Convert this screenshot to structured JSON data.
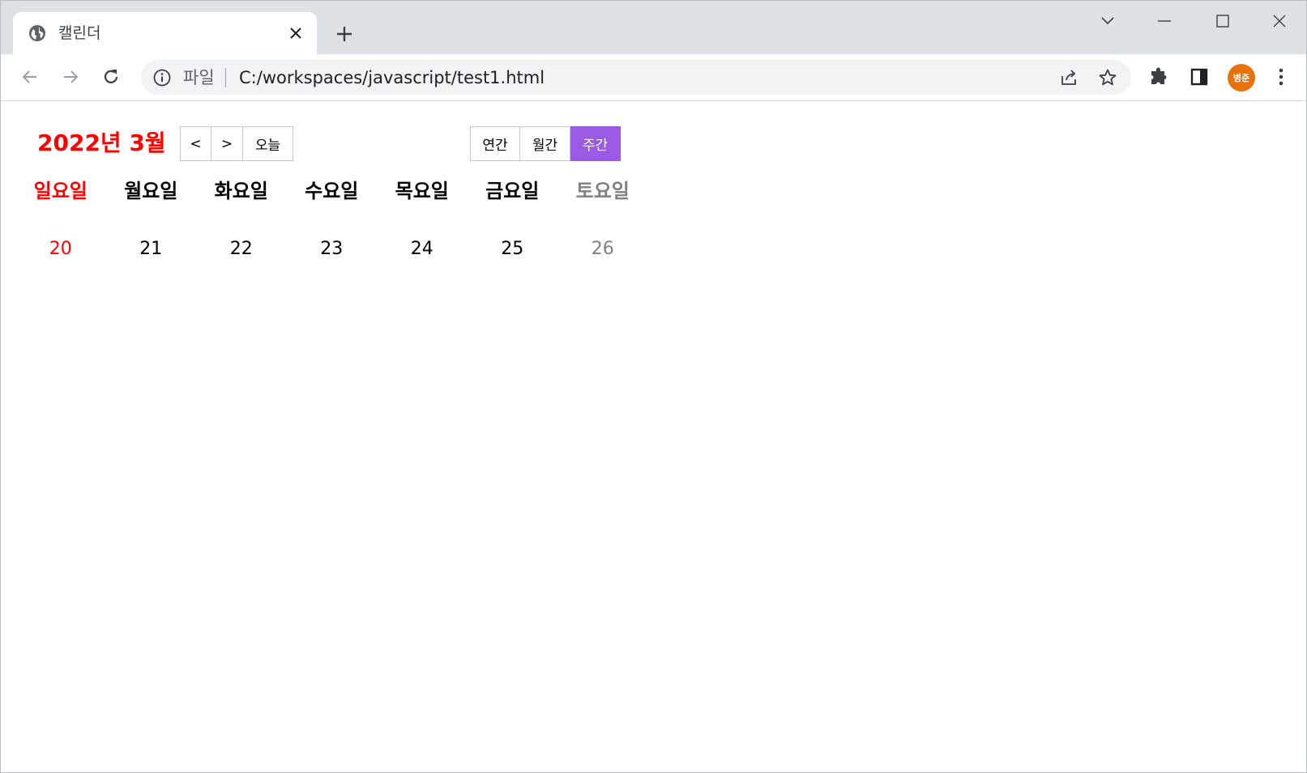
{
  "browser": {
    "tab": {
      "title": "캘린더"
    },
    "address": {
      "scheme_label": "파일",
      "url": "C:/workspaces/javascript/test1.html"
    },
    "profile": {
      "initials": "병준",
      "color": "#e8710a"
    }
  },
  "calendar": {
    "title": "2022년 3월",
    "nav": {
      "prev": "<",
      "next": ">",
      "today": "오늘"
    },
    "views": [
      {
        "label": "연간",
        "active": false
      },
      {
        "label": "월간",
        "active": false
      },
      {
        "label": "주간",
        "active": true
      }
    ],
    "weekdays": [
      "일요일",
      "월요일",
      "화요일",
      "수요일",
      "목요일",
      "금요일",
      "토요일"
    ],
    "dates": [
      "20",
      "21",
      "22",
      "23",
      "24",
      "25",
      "26"
    ],
    "colors": {
      "sunday": "#ff0000",
      "saturday": "#808080",
      "active_view": "#9a5ae3"
    }
  }
}
